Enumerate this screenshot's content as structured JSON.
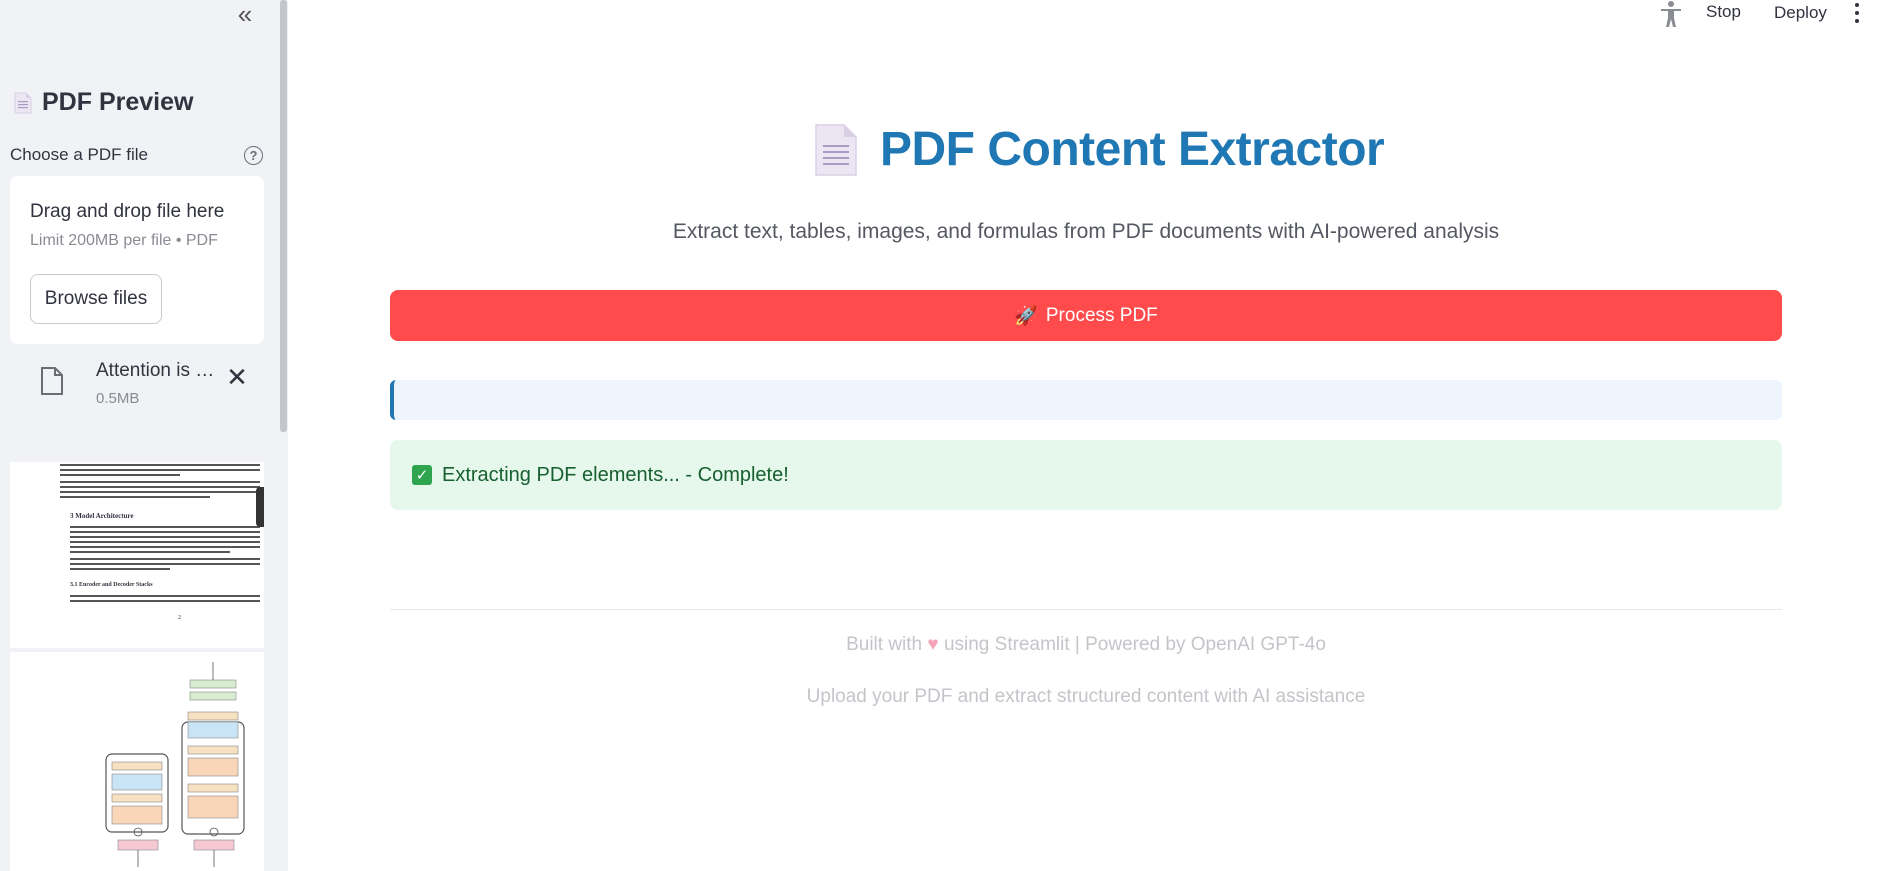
{
  "sidebar": {
    "title": "PDF Preview",
    "uploader_label": "Choose a PDF file",
    "dropzone_title": "Drag and drop file here",
    "dropzone_limit": "Limit 200MB per file • PDF",
    "browse_label": "Browse files",
    "file": {
      "name": "Attention is …",
      "size": "0.5MB"
    },
    "page1_snippets": {
      "section": "3    Model Architecture",
      "subsection": "3.1    Encoder and Decoder Stacks",
      "page_number": "2"
    }
  },
  "header": {
    "stop_label": "Stop",
    "deploy_label": "Deploy"
  },
  "main": {
    "title": "PDF Content Extractor",
    "subtitle": "Extract text, tables, images, and formulas from PDF documents with AI-powered analysis",
    "process_button": "Process PDF",
    "process_icon": "🚀",
    "success_message": "Extracting PDF elements... - Complete!",
    "footer_line1_pre": "Built with",
    "footer_line1_post": "using Streamlit | Powered by OpenAI GPT-4o",
    "footer_line2": "Upload your PDF and extract structured content with AI assistance"
  },
  "colors": {
    "accent": "#1f77b4",
    "primary_button": "#ff4b4b",
    "success_bg": "#e6f7ec",
    "success_text": "#17602f",
    "sidebar_bg": "#f0f2f6"
  }
}
